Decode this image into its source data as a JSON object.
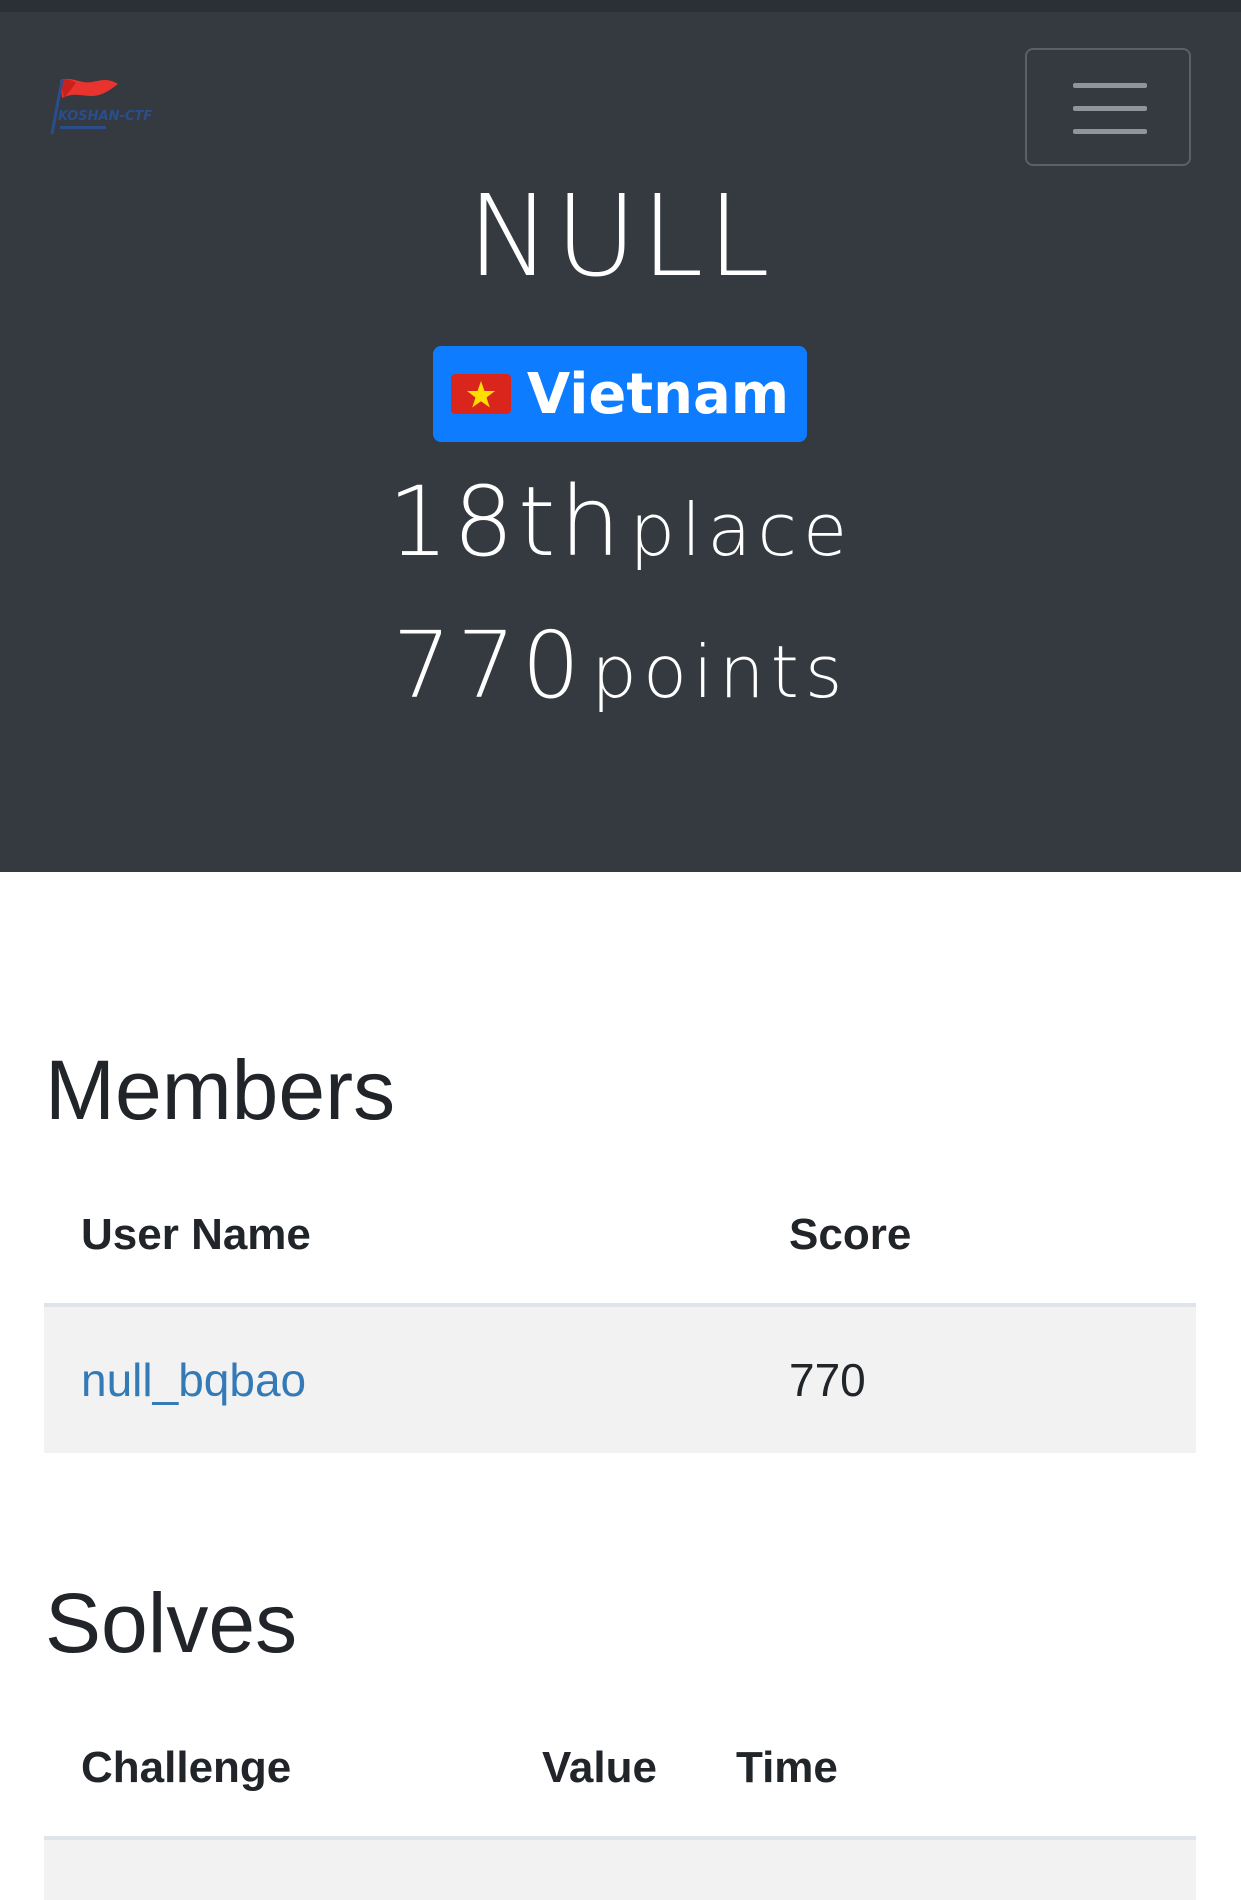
{
  "header": {
    "logo_icon": "red-flag-logo-icon",
    "menu_icon": "hamburger-menu-icon"
  },
  "team": {
    "name": "NULL",
    "country": "Vietnam",
    "country_flag_icon": "vietnam-flag-icon",
    "place_number": "18th",
    "place_word": "place",
    "points_number": "770",
    "points_word": "points"
  },
  "members": {
    "title": "Members",
    "columns": [
      "User Name",
      "Score"
    ],
    "rows": [
      {
        "user": "null_bqbao",
        "score": "770"
      }
    ]
  },
  "solves": {
    "title": "Solves",
    "columns": [
      "Challenge",
      "Value",
      "Time"
    ]
  },
  "colors": {
    "header_bg": "#343a40",
    "badge_bg": "#0d7cff",
    "link": "#337ab7",
    "row_bg": "#f2f2f2"
  }
}
